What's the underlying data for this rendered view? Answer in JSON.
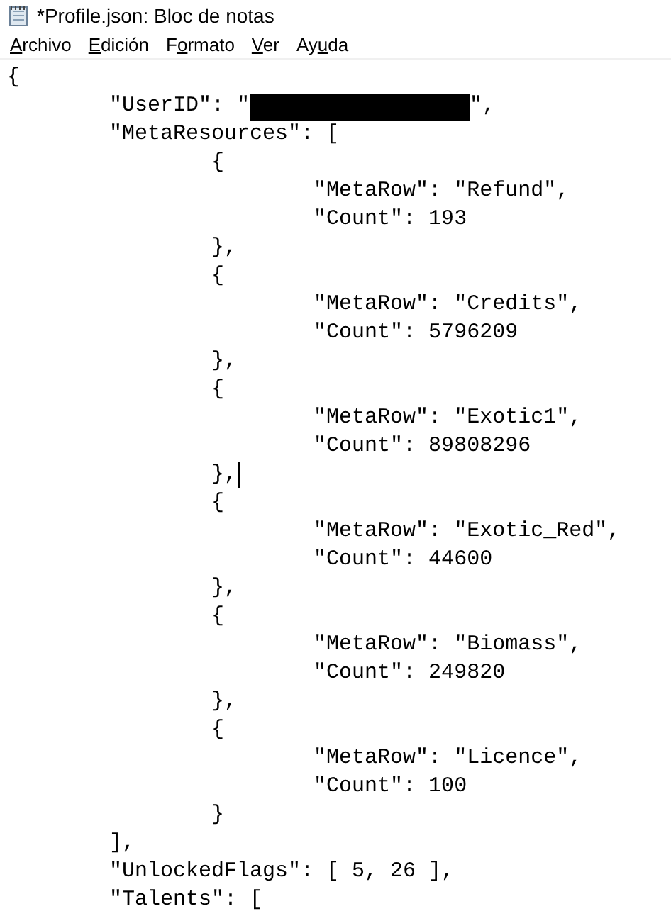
{
  "window": {
    "title": "*Profile.json: Bloc de notas"
  },
  "menu": [
    {
      "key": "A",
      "post": "rchivo"
    },
    {
      "key": "E",
      "post": "dición"
    },
    {
      "pre": "F",
      "key": "o",
      "post": "rmato"
    },
    {
      "key": "V",
      "post": "er"
    },
    {
      "pre": "Ay",
      "key": "u",
      "post": "da"
    }
  ],
  "lines": [
    {
      "kind": "text",
      "text": "{"
    },
    {
      "kind": "redacted",
      "before": "\t\"UserID\": \"",
      "after": "\","
    },
    {
      "kind": "text",
      "text": "\t\"MetaResources\": ["
    },
    {
      "kind": "text",
      "text": "\t\t{"
    },
    {
      "kind": "text",
      "text": "\t\t\t\"MetaRow\": \"Refund\","
    },
    {
      "kind": "text",
      "text": "\t\t\t\"Count\": 193"
    },
    {
      "kind": "text",
      "text": "\t\t},"
    },
    {
      "kind": "text",
      "text": "\t\t{"
    },
    {
      "kind": "text",
      "text": "\t\t\t\"MetaRow\": \"Credits\","
    },
    {
      "kind": "text",
      "text": "\t\t\t\"Count\": 5796209"
    },
    {
      "kind": "text",
      "text": "\t\t},"
    },
    {
      "kind": "text",
      "text": "\t\t{"
    },
    {
      "kind": "text",
      "text": "\t\t\t\"MetaRow\": \"Exotic1\","
    },
    {
      "kind": "text",
      "text": "\t\t\t\"Count\": 89808296"
    },
    {
      "kind": "text",
      "text": "\t\t},",
      "cursor": true
    },
    {
      "kind": "text",
      "text": "\t\t{"
    },
    {
      "kind": "text",
      "text": "\t\t\t\"MetaRow\": \"Exotic_Red\","
    },
    {
      "kind": "text",
      "text": "\t\t\t\"Count\": 44600"
    },
    {
      "kind": "text",
      "text": "\t\t},"
    },
    {
      "kind": "text",
      "text": "\t\t{"
    },
    {
      "kind": "text",
      "text": "\t\t\t\"MetaRow\": \"Biomass\","
    },
    {
      "kind": "text",
      "text": "\t\t\t\"Count\": 249820"
    },
    {
      "kind": "text",
      "text": "\t\t},"
    },
    {
      "kind": "text",
      "text": "\t\t{"
    },
    {
      "kind": "text",
      "text": "\t\t\t\"MetaRow\": \"Licence\","
    },
    {
      "kind": "text",
      "text": "\t\t\t\"Count\": 100"
    },
    {
      "kind": "text",
      "text": "\t\t}"
    },
    {
      "kind": "text",
      "text": "\t],"
    },
    {
      "kind": "text",
      "text": "\t\"UnlockedFlags\": [ 5, 26 ],"
    },
    {
      "kind": "text",
      "text": "\t\"Talents\": ["
    }
  ]
}
